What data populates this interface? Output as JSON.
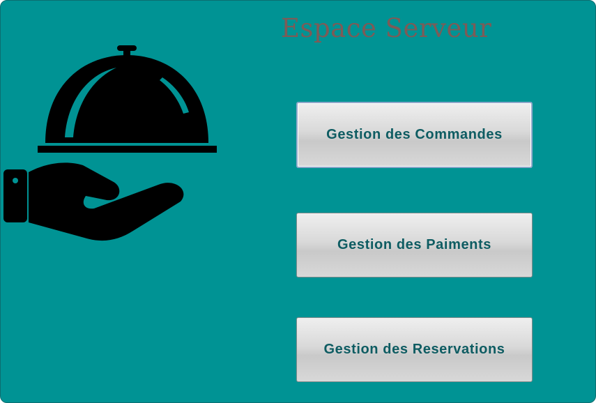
{
  "window": {
    "title": "Espace Serveur",
    "background_color": "#009394",
    "title_color": "#7d5b57",
    "button_text_color": "#0e5c62"
  },
  "illustration": {
    "icon": "waiter-serving-cloche-icon"
  },
  "buttons": [
    {
      "label": "Gestion des Commandes",
      "focused": true
    },
    {
      "label": "Gestion des Paiments",
      "focused": false
    },
    {
      "label": "Gestion des Reservations",
      "focused": false
    }
  ]
}
